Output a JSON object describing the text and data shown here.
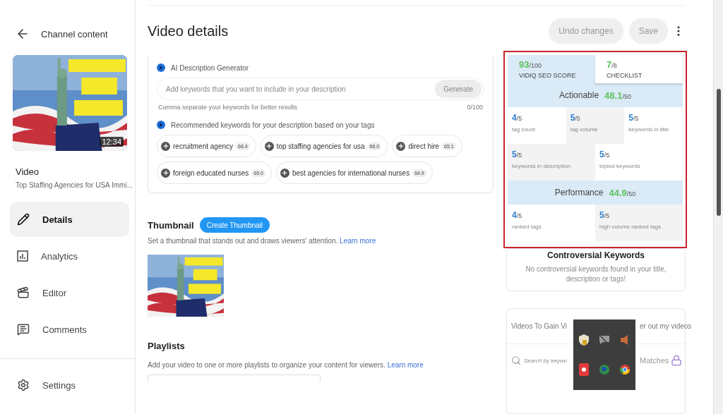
{
  "sidebar": {
    "back_label": "Channel content",
    "video_duration": "12:34",
    "video_heading": "Video",
    "video_title": "Top Staffing Agencies for USA Immi...",
    "nav": [
      {
        "kind": "edit",
        "label": "Details",
        "selected": true
      },
      {
        "kind": "analytics",
        "label": "Analytics",
        "selected": false
      },
      {
        "kind": "editor",
        "label": "Editor",
        "selected": false
      },
      {
        "kind": "comments",
        "label": "Comments",
        "selected": false
      }
    ],
    "settings": "Settings"
  },
  "header": {
    "title": "Video details",
    "buttons": [
      "Undo changes",
      "Save"
    ]
  },
  "ai_generator": {
    "title": "AI Description Generator",
    "placeholder": "Add keywords that you want to include in your description",
    "button": "Generate",
    "hint": "Comma separate your keywords for better results",
    "counter": "0/100",
    "recommend_title": "Recommended keywords for your description based on your tags",
    "keywords": [
      {
        "label": "recruitment agency",
        "score": "66.4"
      },
      {
        "label": "top staffing agencies for usa",
        "score": "66.0"
      },
      {
        "label": "direct hire",
        "score": "65.1"
      },
      {
        "label": "foreign educated nurses",
        "score": "65.0"
      },
      {
        "label": "best agencies for international nurses",
        "score": "64.9"
      }
    ]
  },
  "thumbnail": {
    "title": "Thumbnail",
    "button": "Create Thumbnail",
    "description": "Set a thumbnail that stands out and draws viewers' attention.",
    "link": "Learn more"
  },
  "playlists": {
    "title": "Playlists",
    "description": "Add your video to one or more playlists to organize your content for viewers.",
    "link": "Learn more"
  },
  "seo": {
    "tabs": [
      {
        "score": "93",
        "total": "/100",
        "label": "VIDIQ SEO SCORE",
        "selected": true
      },
      {
        "score": "7",
        "total": "/8",
        "label": "CHECKLIST",
        "selected": false
      }
    ],
    "sections": [
      {
        "title": "Actionable",
        "score": "48.1",
        "total": "/50",
        "rows": [
          [
            {
              "score": "4",
              "total": "/5",
              "label": "tag count"
            },
            {
              "score": "5",
              "total": "/5",
              "label": "tag volume"
            },
            {
              "score": "5",
              "total": "/5",
              "label": "keywords in title"
            }
          ],
          [
            {
              "score": "5",
              "total": "/5",
              "label": "keywords in description"
            },
            {
              "score": "5",
              "total": "/5",
              "label": "tripled keywords"
            }
          ]
        ]
      },
      {
        "title": "Performance",
        "score": "44.9",
        "total": "/50",
        "rows": [
          [
            {
              "score": "4",
              "total": "/5",
              "label": "ranked tags"
            },
            {
              "score": "5",
              "total": "/5",
              "label": "high volume ranked tags"
            }
          ]
        ]
      }
    ]
  },
  "controversial": {
    "title": "Controversial Keywords",
    "message": "No controversial keywords found in your title, description or tags!"
  },
  "videos_card": {
    "title": "Videos To Gain Vi",
    "filter": "er out my videos",
    "search_placeholder": "Search by keywo",
    "matches": "Matches"
  }
}
